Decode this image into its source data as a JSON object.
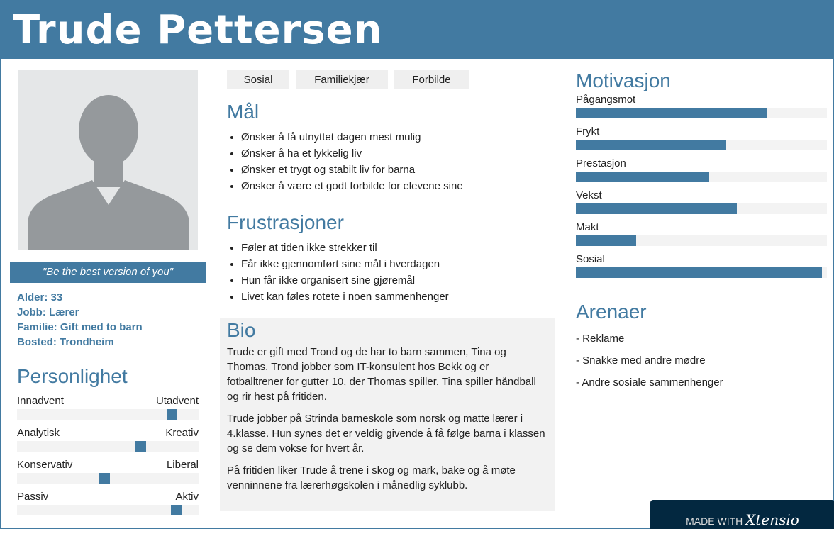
{
  "name": "Trude Pettersen",
  "quote": "\"Be the best version of you\"",
  "facts": [
    "Alder: 33",
    "Jobb: Lærer",
    "Familie: Gift med to barn",
    "Bosted: Trondheim"
  ],
  "personality": {
    "title": "Personlighet",
    "sliders": [
      {
        "left": "Innadvent",
        "right": "Utadvent",
        "value": 0.85
      },
      {
        "left": "Analytisk",
        "right": "Kreativ",
        "value": 0.68
      },
      {
        "left": "Konservativ",
        "right": "Liberal",
        "value": 0.48
      },
      {
        "left": "Passiv",
        "right": "Aktiv",
        "value": 0.875
      }
    ]
  },
  "tags": [
    "Sosial",
    "Familiekjær",
    "Forbilde"
  ],
  "goals": {
    "title": "Mål",
    "items": [
      "Ønsker å få utnyttet dagen mest mulig",
      "Ønsker å ha et lykkelig liv",
      "Ønsker et trygt og stabilt liv for barna",
      "Ønsker å være et godt forbilde for elevene sine"
    ]
  },
  "frustrations": {
    "title": "Frustrasjoner",
    "items": [
      "Føler at tiden ikke strekker til",
      "Får ikke gjennomført sine mål i hverdagen",
      "Hun får ikke organisert sine gjøremål",
      "Livet kan føles rotete i noen sammenhenger"
    ]
  },
  "bio": {
    "title": "Bio",
    "paragraphs": [
      "Trude er gift med Trond og de har to barn sammen, Tina og Thomas. Trond jobber som IT-konsulent hos Bekk og er fotballtrener for gutter 10, der Thomas spiller. Tina spiller håndball og rir hest på fritiden.",
      "Trude jobber på Strinda barneskole som norsk og matte lærer i 4.klasse. Hun synes det er veldig givende å få følge barna i klassen og se dem vokse for hvert år.",
      "På fritiden liker Trude å trene i skog og mark, bake og å møte venninnene fra lærerhøgskolen i månedlig syklubb."
    ]
  },
  "motivation": {
    "title": "Motivasjon",
    "items": [
      {
        "label": "Pågangsmot",
        "value": 0.76
      },
      {
        "label": "Frykt",
        "value": 0.6
      },
      {
        "label": "Prestasjon",
        "value": 0.53
      },
      {
        "label": "Vekst",
        "value": 0.64
      },
      {
        "label": "Makt",
        "value": 0.24
      },
      {
        "label": "Sosial",
        "value": 0.98
      }
    ]
  },
  "arenas": {
    "title": "Arenaer",
    "items": [
      "- Reklame",
      "- Snakke med andre mødre",
      "- Andre sosiale sammenhenger"
    ]
  },
  "badge": {
    "made_with": "MADE WITH",
    "brand": "Xtensio"
  },
  "colors": {
    "accent": "#427aa1",
    "badge": "#032840"
  }
}
